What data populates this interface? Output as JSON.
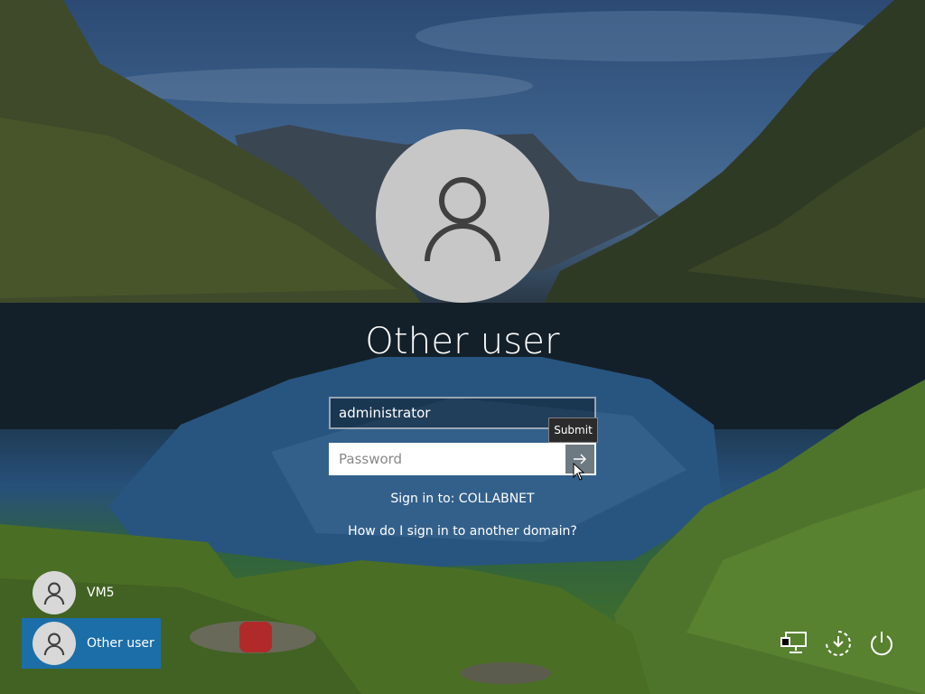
{
  "login": {
    "title": "Other user",
    "username_value": "administrator",
    "password_placeholder": "Password",
    "submit_tooltip": "Submit",
    "sign_in_to": "Sign in to: COLLABNET",
    "domain_help_link": "How do I sign in to another domain?"
  },
  "users": [
    {
      "name": "VM5",
      "selected": false
    },
    {
      "name": "Other user",
      "selected": true
    }
  ],
  "system_icons": [
    "network-icon",
    "ease-of-access-icon",
    "power-icon"
  ],
  "colors": {
    "selected_tile": "#1b6ea8",
    "avatar_bg": "#c7c7c7",
    "submit_button": "#6e7a82"
  }
}
